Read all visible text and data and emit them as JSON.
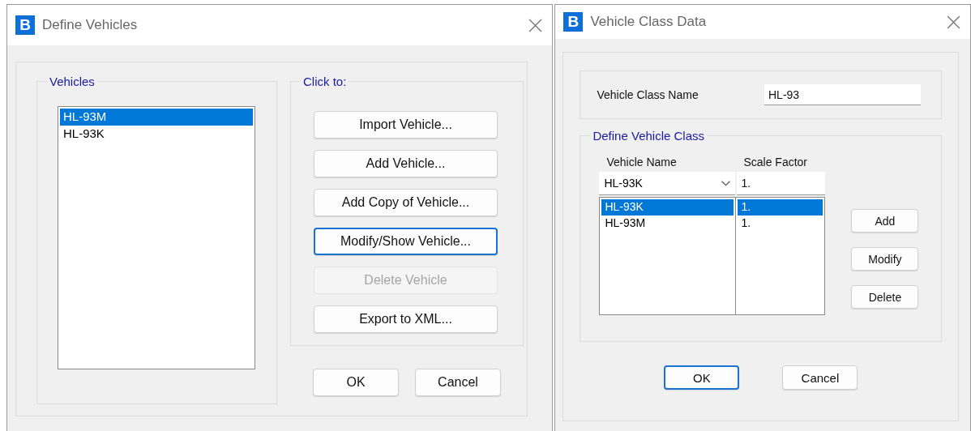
{
  "define_vehicles": {
    "title": "Define Vehicles",
    "app_icon": "B",
    "vehicles_group": {
      "legend": "Vehicles",
      "items": [
        {
          "label": "HL-93M",
          "selected": true
        },
        {
          "label": "HL-93K",
          "selected": false
        }
      ]
    },
    "click_to_group": {
      "legend": "Click to:",
      "buttons": [
        {
          "label": "Import Vehicle...",
          "disabled": false,
          "focused": false
        },
        {
          "label": "Add Vehicle...",
          "disabled": false,
          "focused": false
        },
        {
          "label": "Add Copy of Vehicle...",
          "disabled": false,
          "focused": false
        },
        {
          "label": "Modify/Show Vehicle...",
          "disabled": false,
          "focused": true
        },
        {
          "label": "Delete Vehicle",
          "disabled": true,
          "focused": false
        },
        {
          "label": "Export to XML...",
          "disabled": false,
          "focused": false
        }
      ]
    },
    "footer_buttons": [
      {
        "label": "OK",
        "focused": false
      },
      {
        "label": "Cancel",
        "focused": false
      }
    ]
  },
  "vehicle_class_data": {
    "title": "Vehicle Class Data",
    "app_icon": "B",
    "class_name": {
      "label": "Vehicle Class Name",
      "value": "HL-93"
    },
    "define_group": {
      "legend": "Define Vehicle Class",
      "columns": [
        "Vehicle Name",
        "Scale Factor"
      ],
      "vehicle_select": "HL-93K",
      "scale_input": "1.",
      "rows": [
        {
          "vehicle": "HL-93K",
          "scale": "1.",
          "selected": true
        },
        {
          "vehicle": "HL-93M",
          "scale": "1.",
          "selected": false
        }
      ],
      "buttons": [
        "Add",
        "Modify",
        "Delete"
      ]
    },
    "footer_buttons": [
      {
        "label": "OK",
        "focused": true
      },
      {
        "label": "Cancel",
        "focused": false
      }
    ]
  }
}
